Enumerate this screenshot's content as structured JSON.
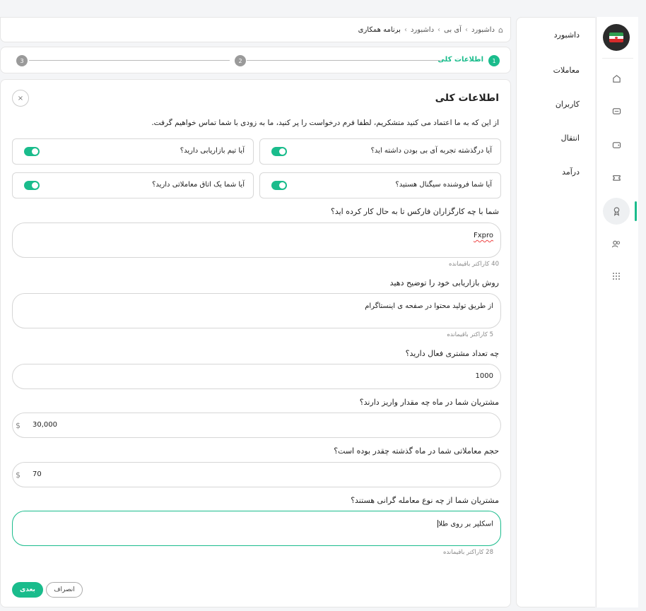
{
  "breadcrumb": {
    "items": [
      "داشبورد",
      "آی بی",
      "داشبورد",
      "برنامه همکاری"
    ]
  },
  "stepper": {
    "steps": [
      {
        "number": "1",
        "label": "اطلاعات کلی"
      },
      {
        "number": "2",
        "label": ""
      },
      {
        "number": "3",
        "label": ""
      }
    ]
  },
  "sidebar": {
    "items": [
      "داشبورد",
      "معاملات",
      "کاربران",
      "انتقال",
      "درآمد"
    ]
  },
  "rail": {
    "icons": [
      "flag-icon",
      "home-icon",
      "card-icon",
      "wallet-icon",
      "ticket-icon",
      "award-icon",
      "users-icon",
      "grid-icon"
    ]
  },
  "form": {
    "title": "اطلاعات کلی",
    "close": "×",
    "intro": "از این که به ما اعتماد می کنید متشکریم، لطفا فرم درخواست را پر کنید، ما به زودی با شما تماس خواهیم گرفت.",
    "toggles": [
      {
        "label": "آیا درگذشته تجربه آی بی بودن داشته اید؟",
        "on": true
      },
      {
        "label": "آیا تیم بازاریابی دارید؟",
        "on": true
      },
      {
        "label": "آیا شما فروشنده سیگنال هستید؟",
        "on": true
      },
      {
        "label": "آیا شما یک اتاق معاملاتی دارید؟",
        "on": true
      }
    ],
    "q1": {
      "label": "شما با چه کارگزاران فارکس تا به حال کار کرده اید؟",
      "value": "Fxpro",
      "counter": "40 کاراکتر باقیمانده"
    },
    "q2": {
      "label": "روش بازاریابی خود را توضیح دهید",
      "value": "از طریق تولید محتوا در صفحه ی اینستاگرام",
      "counter": "5 کاراکتر باقیمانده"
    },
    "q3": {
      "label": "چه تعداد مشتری فعال دارید؟",
      "value": "1000"
    },
    "q4": {
      "label": "مشتریان شما در ماه چه مقدار واریز دارند؟",
      "value": "30,000",
      "currency": "$"
    },
    "q5": {
      "label": "حجم معاملاتی شما در ماه گذشته چقدر بوده است؟",
      "value": "70",
      "currency": "$"
    },
    "q6": {
      "label": "مشتریان شما از چه نوع معامله گرانی هستند؟",
      "value": "اسکلپر بر روی طلا",
      "counter": "28 کاراکتر باقیمانده"
    },
    "buttons": {
      "next": "بعدی",
      "cancel": "انصراف"
    }
  },
  "colors": {
    "accent": "#1abc8c"
  }
}
